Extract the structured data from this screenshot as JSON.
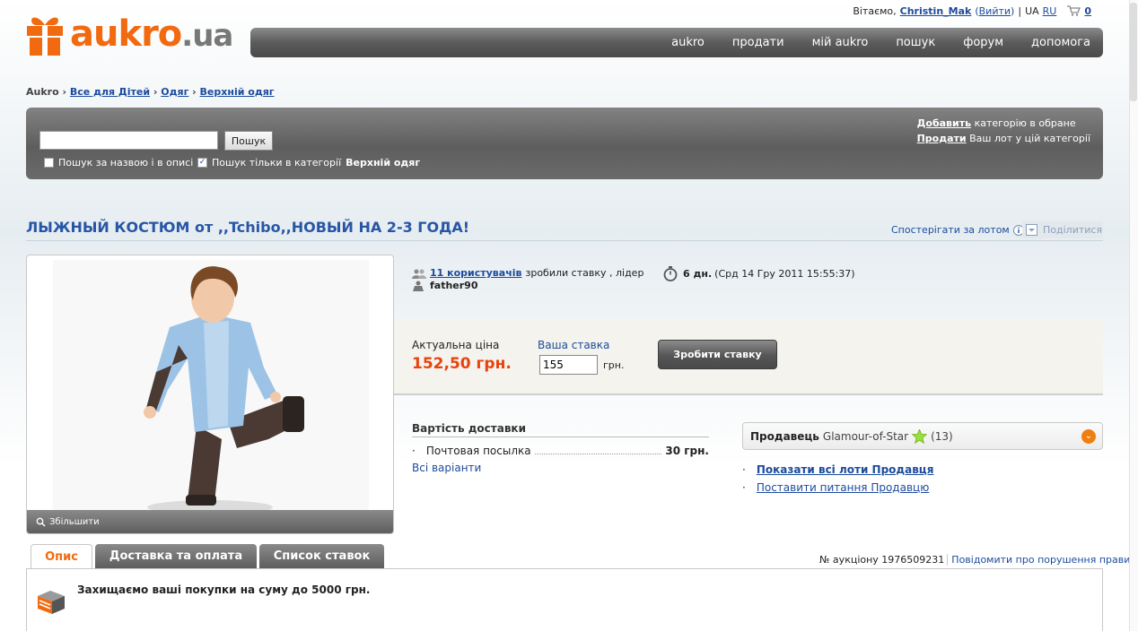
{
  "user_bar": {
    "greeting": "Вітаємо,",
    "username": "Christin_Mak",
    "logout_open": "(",
    "logout": "Вийти",
    "logout_close": ")",
    "sep": "|",
    "lang_ua": "UA",
    "lang_ru": "RU",
    "cart_count": "0"
  },
  "logo": {
    "brand": "aukro",
    "tld": ".ua"
  },
  "nav": [
    "aukro",
    "продати",
    "мій aukro",
    "пошук",
    "форум",
    "допомога"
  ],
  "breadcrumb": {
    "home": "Aukro",
    "sep": "›",
    "items": [
      "Все для Дітей",
      "Одяг",
      "Верхній одяг"
    ]
  },
  "search": {
    "value": "",
    "button": "Пошук",
    "opt1": "Пошук за назвою і в описі",
    "opt2_prefix": "Пошук тільки в категорії",
    "opt2_category": "Верхній одяг",
    "add_link": "Добавить",
    "add_text": "категорію в обране",
    "sell_link": "Продати",
    "sell_text": "Ваш лот у цій категорії"
  },
  "title": "ЛЫЖНЫЙ КОСТЮМ от ,,Tchibo,,НОВЫЙ НА 2-3 ГОДА!",
  "watch": "Спостерігати за лотом",
  "share": "Поділитися",
  "zoom": "Збільшити",
  "bidders": {
    "link": "11 користувачів",
    "text": "зробили ставку , лідер",
    "leader": "father90"
  },
  "timer": {
    "days": "6 дн.",
    "date": "(Срд 14 Гру 2011 15:55:37)"
  },
  "price": {
    "label": "Актуальна ціна",
    "value": "152,50 грн.",
    "your_bid_label": "Ваша ставка",
    "your_bid": "155",
    "currency": "грн.",
    "bid_button": "Зробити ставку"
  },
  "shipping": {
    "title": "Вартість доставки",
    "method": "Почтовая посылка",
    "cost": "30 грн.",
    "all": "Всі варіанти"
  },
  "seller": {
    "label": "Продавець",
    "name": "Glamour-of-Star",
    "rating": "(13)",
    "link1": "Показати всі лоти Продавця",
    "link2": "Поставити питання Продавцю"
  },
  "tabs": [
    "Опис",
    "Доставка та оплата",
    "Список ставок"
  ],
  "auction": {
    "label": "№ аукціону 1976509231",
    "report": "Повідомити про порушення правил"
  },
  "protect": "Захищаємо ваші покупки на суму до 5000 грн.",
  "colors": {
    "brand": "#f26a10",
    "link": "#1c4b9c",
    "price": "#e8420d"
  }
}
